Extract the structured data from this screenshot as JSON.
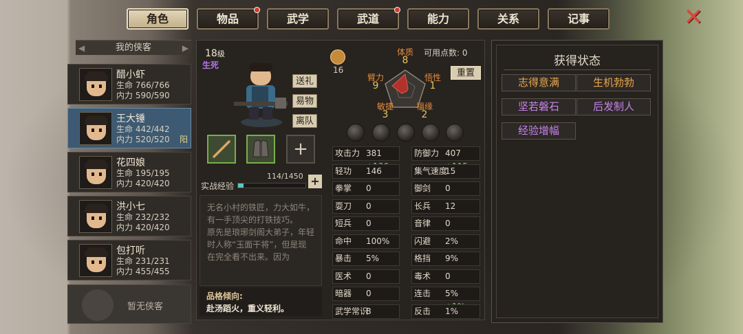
{
  "tabs": [
    {
      "label": "角色",
      "active": true,
      "dot": false
    },
    {
      "label": "物品",
      "active": false,
      "dot": true
    },
    {
      "label": "武学",
      "active": false,
      "dot": false
    },
    {
      "label": "武道",
      "active": false,
      "dot": true
    },
    {
      "label": "能力",
      "active": false,
      "dot": false
    },
    {
      "label": "关系",
      "active": false,
      "dot": false
    },
    {
      "label": "记事",
      "active": false,
      "dot": false
    }
  ],
  "close_icon": "✕",
  "roster": {
    "header": "我的侠客",
    "members": [
      {
        "name": "醋小虾",
        "hp": "生命 766/766",
        "mp": "内力 590/590",
        "selected": false,
        "tag": ""
      },
      {
        "name": "王大锤",
        "hp": "生命 442/442",
        "mp": "内力 520/520",
        "selected": true,
        "tag": "阳"
      },
      {
        "name": "花四娘",
        "hp": "生命 195/195",
        "mp": "内力 420/420",
        "selected": false,
        "tag": ""
      },
      {
        "name": "洪小七",
        "hp": "生命 232/232",
        "mp": "内力 420/420",
        "selected": false,
        "tag": ""
      },
      {
        "name": "包打听",
        "hp": "生命 231/231",
        "mp": "内力 455/455",
        "selected": false,
        "tag": ""
      }
    ],
    "empty_label": "暂无侠客"
  },
  "profile": {
    "level": "18",
    "level_unit": "级",
    "sect": "生死",
    "actions": [
      "送礼",
      "易物",
      "离队"
    ],
    "xp_label": "实战经验",
    "xp_value": "114/1450",
    "xp_fraction": 0.0786,
    "add_slot": "+",
    "xp_plus": "+",
    "description": [
      "无名小村的铁匠，力大如牛，有一手顶尖的打铁技巧。",
      "原先是琅琊剑阁大弟子，年轻时人称“玉面干将”，但是现在完全看不出来。因为"
    ],
    "trait_title": "品格倾向:",
    "trait_value": "赴汤蹈火，重义轻利。"
  },
  "attributes": {
    "sword_count": "16",
    "points_label": "可用点数: 0",
    "reset": "重置",
    "items": [
      {
        "label": "体质",
        "value": "8"
      },
      {
        "label": "悟性",
        "value": "1"
      },
      {
        "label": "福缘",
        "value": "2"
      },
      {
        "label": "敏捷",
        "value": "3"
      },
      {
        "label": "臂力",
        "value": "9"
      }
    ]
  },
  "stats": [
    {
      "label": "攻击力",
      "value": "381",
      "bonus": "+136"
    },
    {
      "label": "防御力",
      "value": "407",
      "bonus": "+115"
    },
    {
      "label": "轻功",
      "value": "146",
      "bonus": ""
    },
    {
      "label": "集气速度",
      "value": "15",
      "bonus": ""
    },
    {
      "label": "拳掌",
      "value": "0",
      "bonus": ""
    },
    {
      "label": "御剑",
      "value": "0",
      "bonus": ""
    },
    {
      "label": "耍刀",
      "value": "0",
      "bonus": ""
    },
    {
      "label": "长兵",
      "value": "12",
      "bonus": ""
    },
    {
      "label": "短兵",
      "value": "0",
      "bonus": ""
    },
    {
      "label": "音律",
      "value": "0",
      "bonus": ""
    },
    {
      "label": "命中",
      "value": "100%",
      "bonus": ""
    },
    {
      "label": "闪避",
      "value": "2%",
      "bonus": ""
    },
    {
      "label": "暴击",
      "value": "5%",
      "bonus": ""
    },
    {
      "label": "格挡",
      "value": "9%",
      "bonus": ""
    },
    {
      "label": "医术",
      "value": "0",
      "bonus": ""
    },
    {
      "label": "毒术",
      "value": "0",
      "bonus": ""
    },
    {
      "label": "暗器",
      "value": "0",
      "bonus": ""
    },
    {
      "label": "连击",
      "value": "5%",
      "bonus": "+1%"
    },
    {
      "label": "武学常识",
      "value": "8",
      "bonus": ""
    },
    {
      "label": "反击",
      "value": "1%",
      "bonus": ""
    }
  ],
  "status": {
    "title": "获得状态",
    "items": [
      {
        "label": "志得意满",
        "color": "#e8a64a"
      },
      {
        "label": "生机勃勃",
        "color": "#e8a64a"
      },
      {
        "label": "坚若磐石",
        "color": "#c782ec"
      },
      {
        "label": "后发制人",
        "color": "#c782ec"
      },
      {
        "label": "经验增幅",
        "color": "#c782ec"
      }
    ]
  }
}
